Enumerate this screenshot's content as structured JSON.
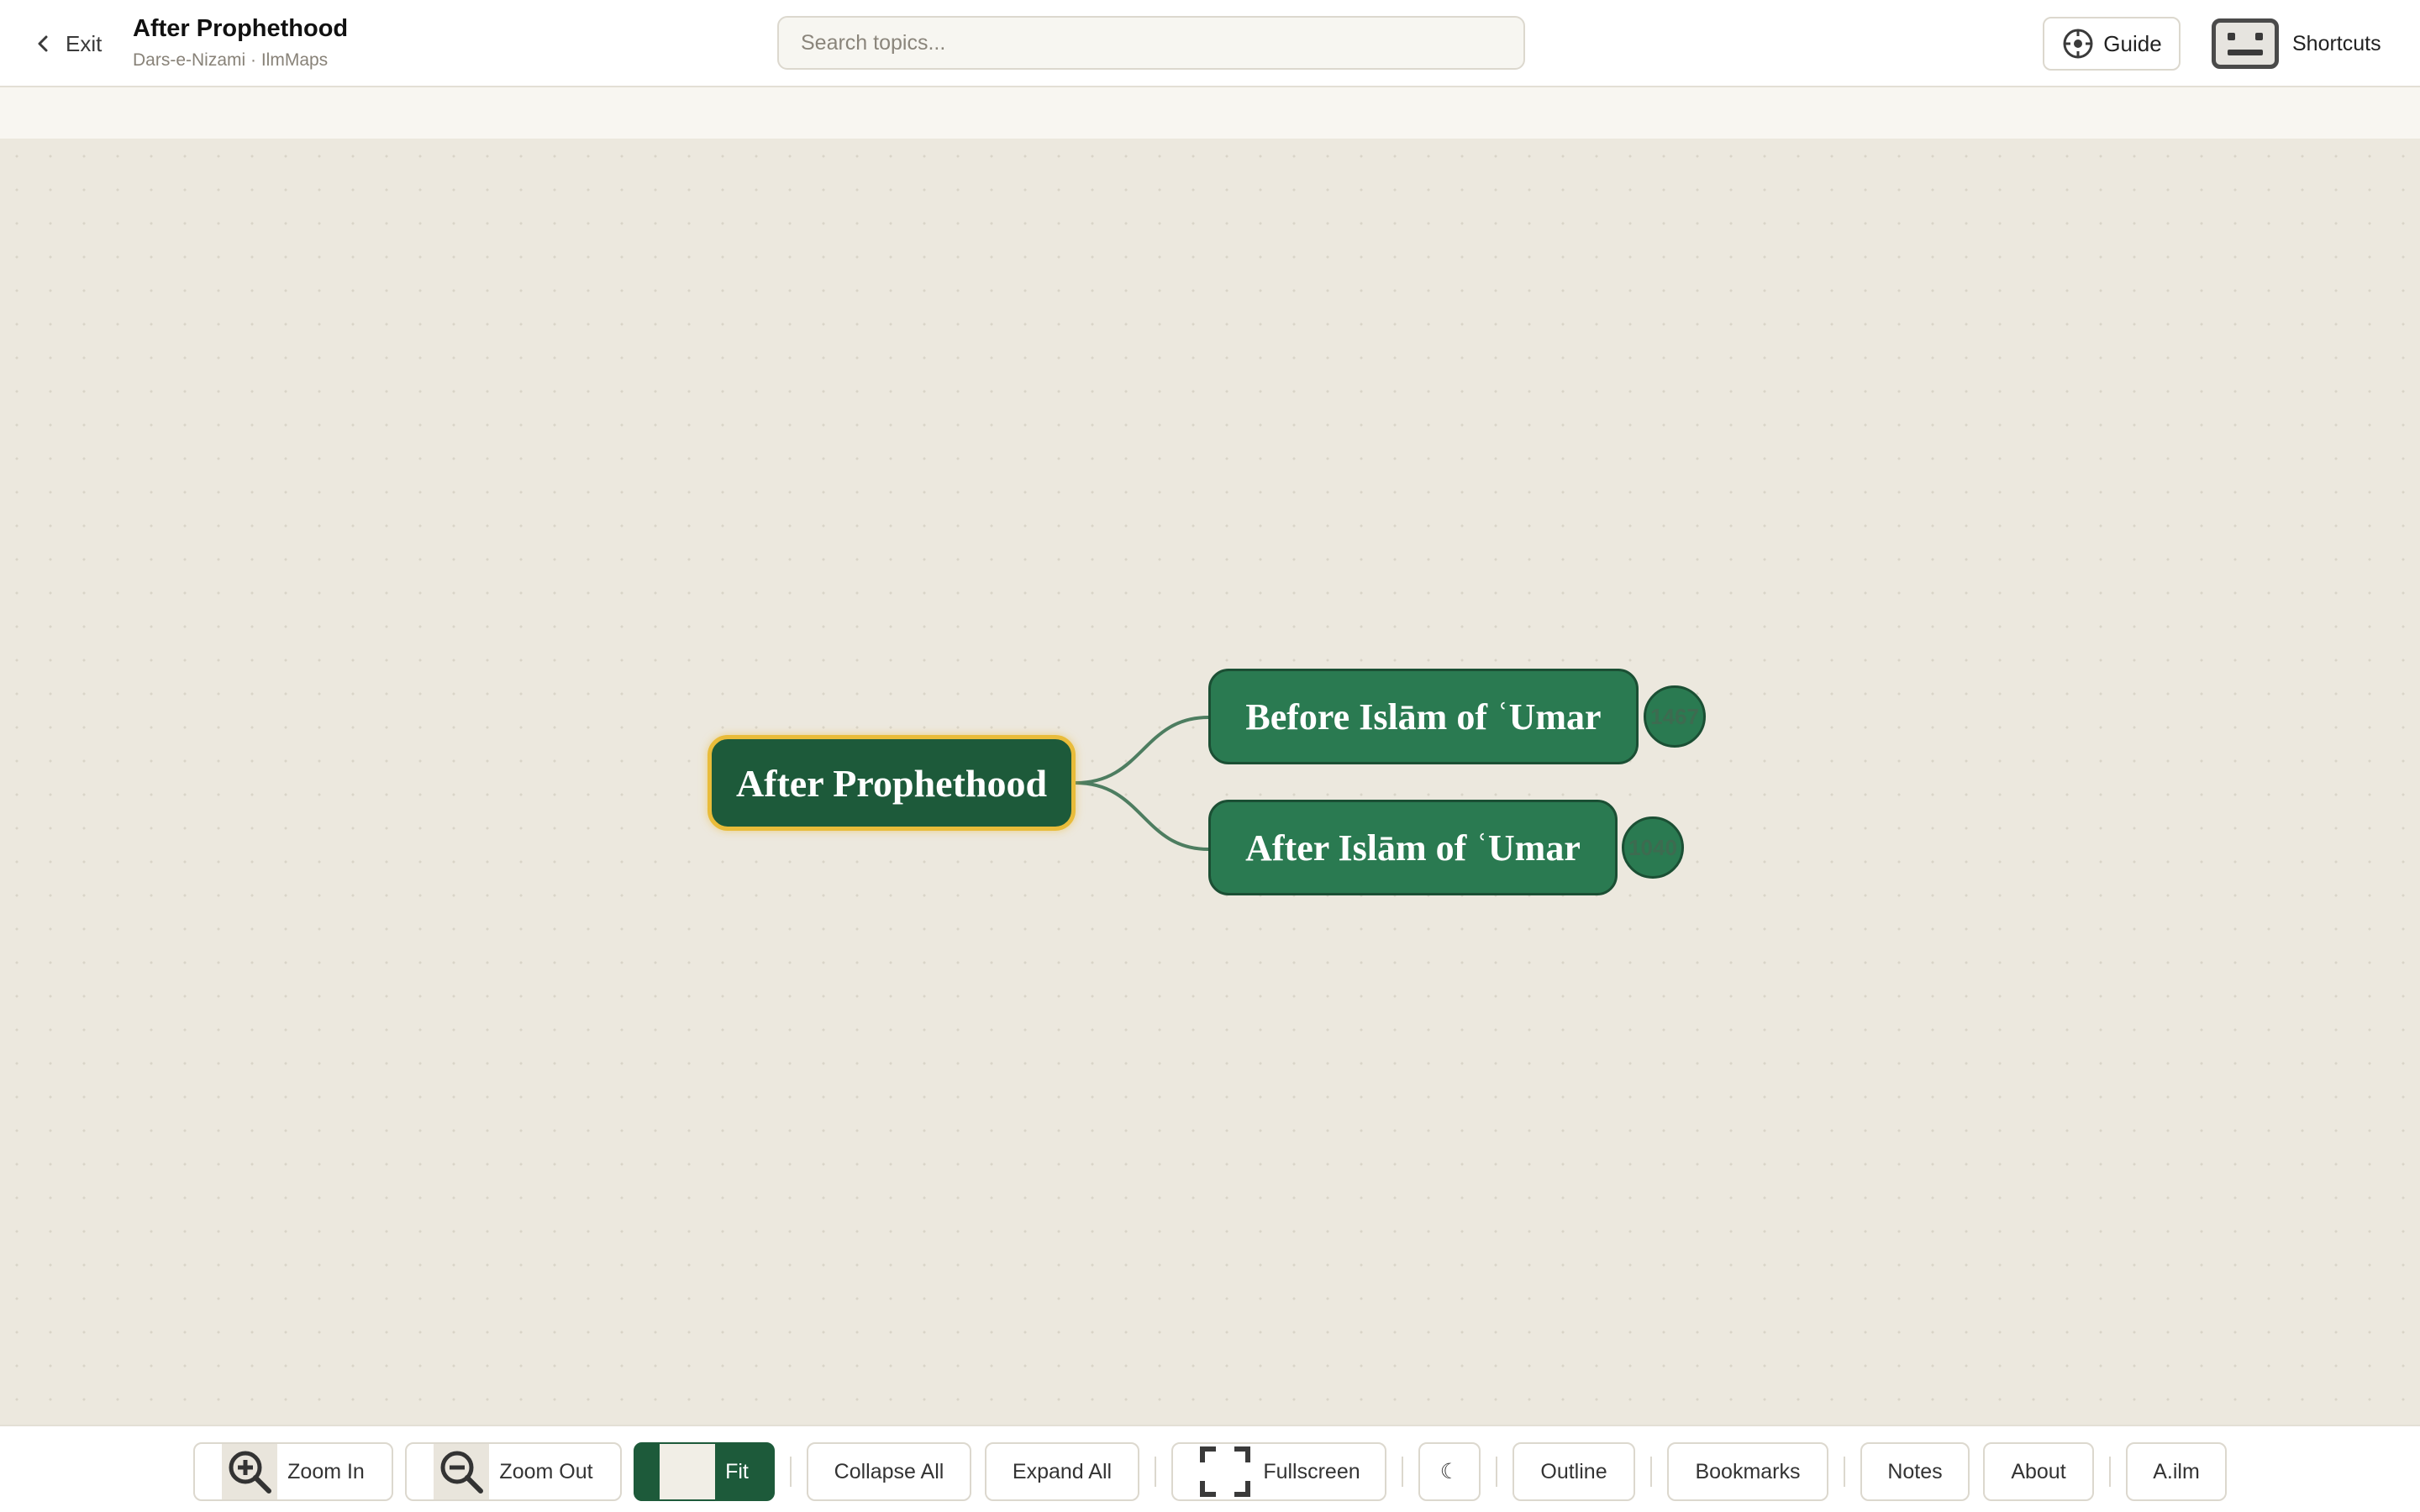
{
  "header": {
    "exit_label": "Exit",
    "title": "After Prophethood",
    "subtitle": "Dars-e-Nizami · IlmMaps",
    "search_placeholder": "Search topics...",
    "guide_label": "Guide",
    "shortcuts_label": "Shortcuts"
  },
  "mindmap": {
    "root": {
      "label": "After Prophethood"
    },
    "children": [
      {
        "label": "Before Islām of ʿUmar",
        "badge": "1467"
      },
      {
        "label": "After Islām of ʿUmar",
        "badge": "1040"
      }
    ]
  },
  "toolbar": {
    "zoom_in": "Zoom In",
    "zoom_out": "Zoom Out",
    "fit": "Fit",
    "collapse_all": "Collapse All",
    "expand_all": "Expand All",
    "fullscreen": "Fullscreen",
    "theme": "☾",
    "outline": "Outline",
    "bookmarks": "Bookmarks",
    "notes": "Notes",
    "about": "About",
    "ailm": "A.ilm"
  },
  "colors": {
    "root_node": "#1d5a3a",
    "root_border": "#e9bc3a",
    "child_node": "#2a7a51",
    "edge": "#4d7d60",
    "canvas": "#ece8de"
  }
}
